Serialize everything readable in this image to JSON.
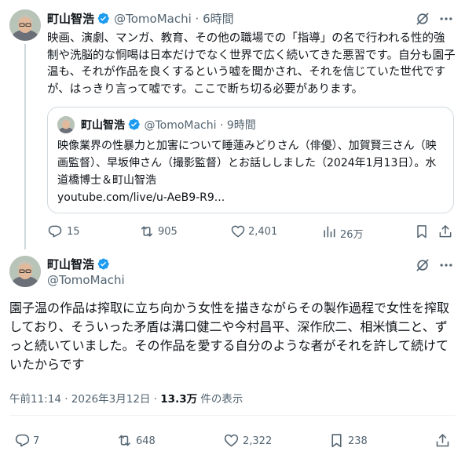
{
  "main_tweet": {
    "author_name": "町山智浩",
    "handle": "@TomoMachi",
    "time": "6時間",
    "text": "映画、演劇、マンガ、教育、その他の職場での「指導」の名で行われる性的強制や洗脳的な恫喝は日本だけでなく世界で広く続いてきた悪習です。自分も園子温も、それが作品を良くするという嘘を聞かされ、それを信じていた世代ですが、はっきり言って嘘です。ここで断ち切る必要があります。",
    "quote": {
      "author_name": "町山智浩",
      "handle": "@TomoMachi",
      "time": "9時間",
      "text": "映像業界の性暴力と加害について睡蓮みどりさん（俳優）、加賀賢三さん（映画監督）、早坂伸さん（撮影監督）とお話ししました（2024年1月13日）。水道橋博士＆町山智浩",
      "link": "youtube.com/live/u-AeB9-R9..."
    },
    "stats": {
      "replies": "15",
      "reposts": "905",
      "likes": "2,401",
      "views": "26万"
    }
  },
  "reply_tweet": {
    "author_name": "町山智浩",
    "handle": "@TomoMachi",
    "text": "園子温の作品は搾取に立ち向かう女性を描きながらその製作過程で女性を搾取しており、そういった矛盾は溝口健二や今村昌平、深作欣二、相米慎二と、ずっと続いていました。その作品を愛する自分のような者がそれを許して続けていたからです",
    "timestamp": "午前11:14 · 2026年3月12日 · ",
    "view_count": "13.3万",
    "view_label": " 件の表示",
    "stats": {
      "replies": "7",
      "reposts": "648",
      "likes": "2,322",
      "bookmarks": "238"
    }
  },
  "icons": [
    "grok-icon",
    "more-icon",
    "verified-badge-icon",
    "reply-icon",
    "repost-icon",
    "like-icon",
    "views-icon",
    "bookmark-icon",
    "share-icon"
  ],
  "colors": {
    "verified": "#1d9bf0",
    "secondary_text": "#536471",
    "border": "#cfd9de"
  }
}
